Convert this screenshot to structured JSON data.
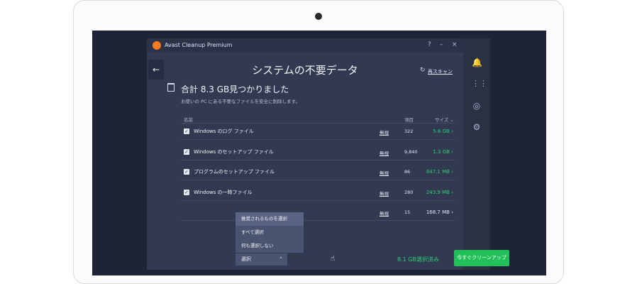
{
  "app": {
    "title": "Avast Cleanup Premium",
    "help": "?",
    "minimize": "–",
    "close": "×"
  },
  "page": {
    "title": "システムの不要データ",
    "rescan": "再スキャン",
    "headline": "合計 8.3 GB見つかりました",
    "subline": "お使いの PC にある不要なファイルを安全に削除します。"
  },
  "table": {
    "columns": {
      "name": "名前",
      "items": "項目",
      "size": "サイズ"
    },
    "rows": [
      {
        "name": "Windows のログ ファイル",
        "ignore": "無視",
        "count": "322",
        "size": "5.6 GB",
        "color": "#2ecc71"
      },
      {
        "name": "Windows のセットアップ ファイル",
        "ignore": "無視",
        "count": "9,840",
        "size": "1.3 GB",
        "color": "#2ecc71"
      },
      {
        "name": "プログラムのセットアップ ファイル",
        "ignore": "無視",
        "count": "86",
        "size": "847.1 MB",
        "color": "#2ecc71"
      },
      {
        "name": "Windows の一時ファイル",
        "ignore": "無視",
        "count": "280",
        "size": "243.9 MB",
        "color": "#2ecc71"
      },
      {
        "name": "",
        "ignore": "無視",
        "count": "15",
        "size": "168.7 MB",
        "color": "#dfe3ee"
      }
    ]
  },
  "dropdown": {
    "options": [
      "推奨されるものを選択",
      "すべて選択",
      "何も選択しない"
    ],
    "button_label": "選択"
  },
  "footer": {
    "selected": "8.1 GB選択済み",
    "clean_button": "今すぐクリーンアップ"
  }
}
